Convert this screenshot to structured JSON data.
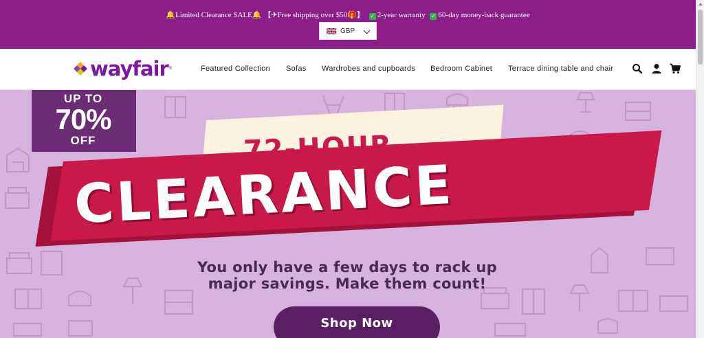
{
  "announcement": {
    "part1": "🔔Limited Clearance SALE🔔",
    "part2": "【✈Free shipping over $50🎁】",
    "part3": "2-year warranty",
    "part4": "60-day money-back guarantee"
  },
  "currency": {
    "selected": "GBP"
  },
  "logo": {
    "text": "wayfair",
    "tm": "®"
  },
  "nav": {
    "items": [
      {
        "label": "Featured Collection"
      },
      {
        "label": "Sofas"
      },
      {
        "label": "Wardrobes and cupboards"
      },
      {
        "label": "Bedroom Cabinet"
      },
      {
        "label": "Terrace dining table and chair"
      }
    ]
  },
  "icons": {
    "search": "search-icon",
    "account": "account-icon",
    "cart": "cart-icon"
  },
  "hero": {
    "badge_line1": "UP TO",
    "badge_line2": "70%",
    "badge_line3": "OFF",
    "headline_top": "72-HOUR",
    "headline_main": "CLEARANCE",
    "subtitle_line1": "You only have a few days to rack up",
    "subtitle_line2": "major savings. Make them count!",
    "cta": "Shop Now"
  },
  "colors": {
    "announce_bg": "#8c1d8a",
    "hero_bg": "#d5b3dc",
    "badge_bg": "#6b2b75",
    "red_band": "#c9184a",
    "cta_bg": "#5b1f66",
    "logo": "#7b189f"
  }
}
